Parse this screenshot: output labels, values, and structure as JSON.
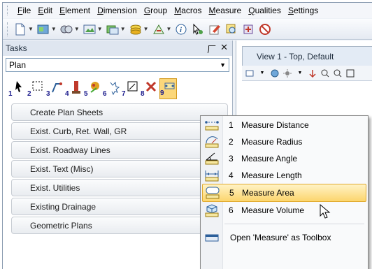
{
  "menubar": {
    "items": [
      "File",
      "Edit",
      "Element",
      "Dimension",
      "Group",
      "Macros",
      "Measure",
      "Qualities",
      "Settings"
    ]
  },
  "toolbar": {
    "icons": [
      "new-file-icon",
      "attributes-icon",
      "levels-icon",
      "display-icon",
      "references-icon",
      "layers-icon",
      "models-icon",
      "info-icon",
      "select-icon",
      "edit-icon",
      "search-icon",
      "add-icon",
      "cancel-icon"
    ]
  },
  "tasks": {
    "title": "Tasks",
    "pin": "⼚",
    "close": "✕",
    "combo_value": "Plan",
    "tool_numbers": [
      "1",
      "2",
      "3",
      "4",
      "5",
      "6",
      "7",
      "8",
      "9"
    ],
    "items": [
      "Create Plan Sheets",
      "Exist. Curb, Ret. Wall, GR",
      "Exist. Roadway Lines",
      "Exist. Text (Misc)",
      "Exist. Utilities",
      "Existing Drainage",
      "Geometric Plans"
    ]
  },
  "view": {
    "title": "View 1 - Top, Default"
  },
  "popup": {
    "items": [
      {
        "num": "1",
        "label": "Measure Distance",
        "icon": "measure-distance-icon"
      },
      {
        "num": "2",
        "label": "Measure Radius",
        "icon": "measure-radius-icon"
      },
      {
        "num": "3",
        "label": "Measure Angle",
        "icon": "measure-angle-icon"
      },
      {
        "num": "4",
        "label": "Measure Length",
        "icon": "measure-length-icon"
      },
      {
        "num": "5",
        "label": "Measure Area",
        "icon": "measure-area-icon"
      },
      {
        "num": "6",
        "label": "Measure Volume",
        "icon": "measure-volume-icon"
      }
    ],
    "footer": "Open 'Measure' as Toolbox",
    "highlighted_index": 4,
    "highlight_color": "#fcd56d"
  }
}
